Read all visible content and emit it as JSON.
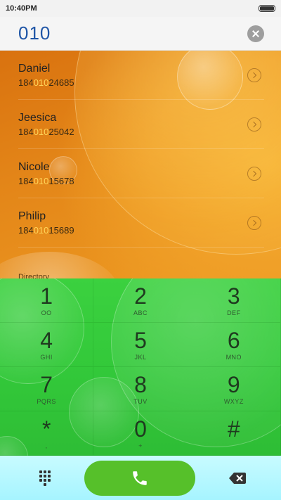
{
  "status_bar": {
    "time": "10:40PM"
  },
  "search": {
    "value": "010"
  },
  "contacts": [
    {
      "name": "Daniel",
      "number_pre": "184",
      "number_match": "010",
      "number_post": "24685"
    },
    {
      "name": "Jeesica",
      "number_pre": "184",
      "number_match": "010",
      "number_post": "25042"
    },
    {
      "name": "Nicole",
      "number_pre": "184",
      "number_match": "010",
      "number_post": "15678"
    },
    {
      "name": "Philip",
      "number_pre": "184",
      "number_match": "010",
      "number_post": "15689"
    }
  ],
  "directory_label": "Directory",
  "keypad": [
    {
      "digit": "1",
      "letters": "OO"
    },
    {
      "digit": "2",
      "letters": "ABC"
    },
    {
      "digit": "3",
      "letters": "DEF"
    },
    {
      "digit": "4",
      "letters": "GHI"
    },
    {
      "digit": "5",
      "letters": "JKL"
    },
    {
      "digit": "6",
      "letters": "MNO"
    },
    {
      "digit": "7",
      "letters": "PQRS"
    },
    {
      "digit": "8",
      "letters": "TUV"
    },
    {
      "digit": "9",
      "letters": "WXYZ"
    },
    {
      "digit": "*",
      "letters": ","
    },
    {
      "digit": "0",
      "letters": "+"
    },
    {
      "digit": "#",
      "letters": ""
    }
  ],
  "colors": {
    "search_text": "#1f55a6",
    "match_highlight": "#ffd55a",
    "keypad_bg": "#33c93a",
    "call_button": "#56c02a",
    "action_bar": "#a6f4ff"
  }
}
